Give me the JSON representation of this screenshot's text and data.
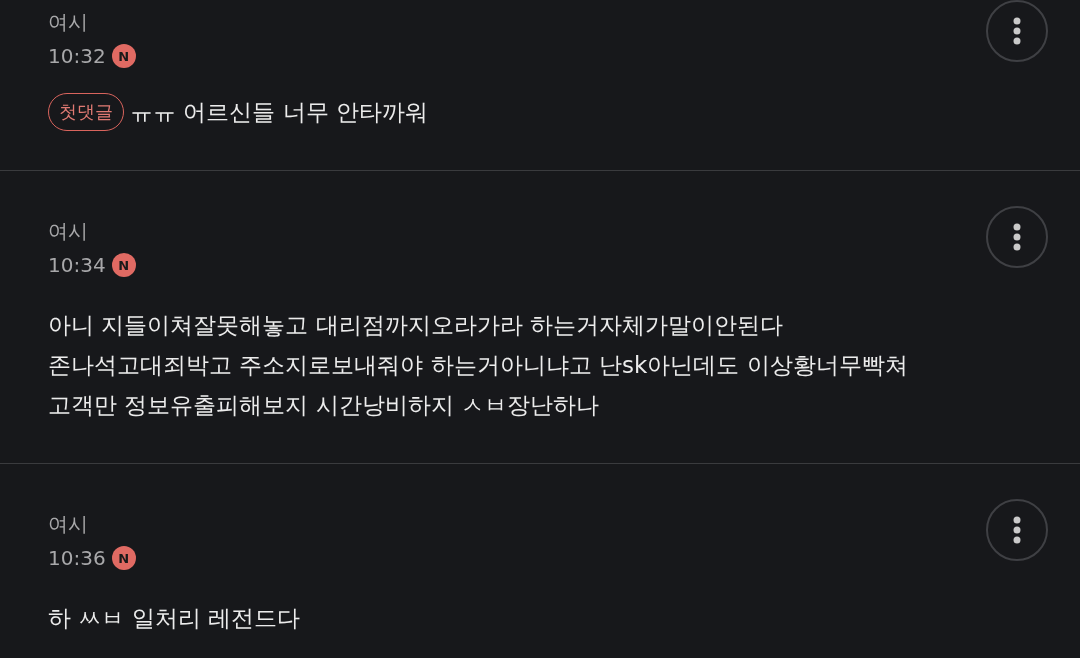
{
  "comments": [
    {
      "author": "여시",
      "time": "10:32",
      "badge": "N",
      "tag": "첫댓글",
      "body": "ㅠㅠ 어르신들 너무 안타까워"
    },
    {
      "author": "여시",
      "time": "10:34",
      "badge": "N",
      "body": "아니 지들이쳐잘못해놓고 대리점까지오라가라 하는거자체가말이안된다\n존나석고대죄박고 주소지로보내줘야 하는거아니냐고 난sk아닌데도 이상황너무빡쳐\n고객만 정보유출피해보지 시간낭비하지 ㅅㅂ장난하나"
    },
    {
      "author": "여시",
      "time": "10:36",
      "badge": "N",
      "body": "하 ㅆㅂ 일처리 레전드다"
    }
  ]
}
